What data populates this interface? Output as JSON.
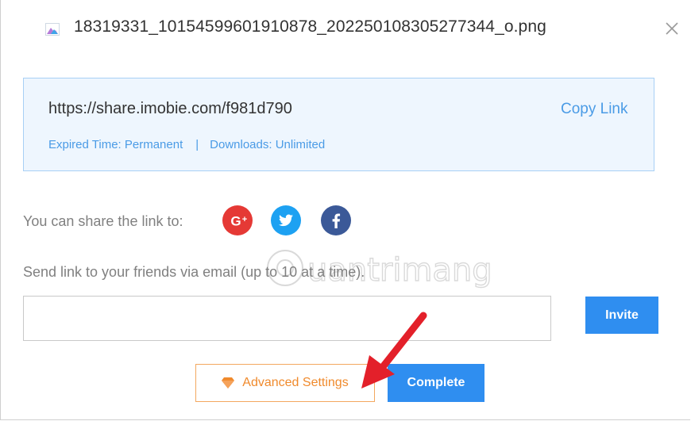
{
  "header": {
    "file_name": "18319331_10154599601910878_202250108305277344_o.png",
    "file_icon": "image-file-icon",
    "close_icon": "close-icon"
  },
  "link_box": {
    "url": "https://share.imobie.com/f981d790",
    "copy_label": "Copy Link",
    "expired": "Expired Time: Permanent",
    "separator": "|",
    "downloads": "Downloads: Unlimited"
  },
  "share": {
    "label": "You can share the link to:",
    "networks": [
      "google-plus-icon",
      "twitter-icon",
      "facebook-icon"
    ]
  },
  "email": {
    "label": "Send link to your friends via email (up to 10 at a time).",
    "value": "",
    "placeholder": "",
    "invite_label": "Invite"
  },
  "footer": {
    "advanced_label": "Advanced Settings",
    "complete_label": "Complete"
  },
  "colors": {
    "accent": "#2f8ef0",
    "link": "#4a9be6",
    "warning": "#f08a2c",
    "google": "#e53935",
    "twitter": "#1da1f2",
    "facebook": "#3b5998",
    "annotation_arrow": "#e3202a"
  }
}
